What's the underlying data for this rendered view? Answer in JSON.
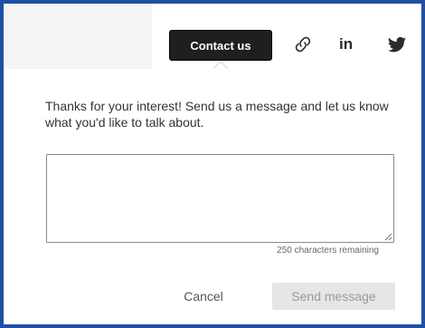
{
  "header": {
    "contact_label": "Contact us",
    "icons": [
      "link-icon",
      "linkedin-icon",
      "twitter-icon"
    ],
    "linkedin_text": "in"
  },
  "dialog": {
    "message": "Thanks for your interest! Send us a message and let us know what you'd like to talk about.",
    "textarea_value": "",
    "remaining": "250 characters remaining",
    "cancel_label": "Cancel",
    "send_label": "Send message",
    "send_enabled": false
  },
  "colors": {
    "frame_border": "#1f4fa5",
    "contact_bg": "#1f1f1f",
    "send_disabled_bg": "#e6e6e6"
  }
}
